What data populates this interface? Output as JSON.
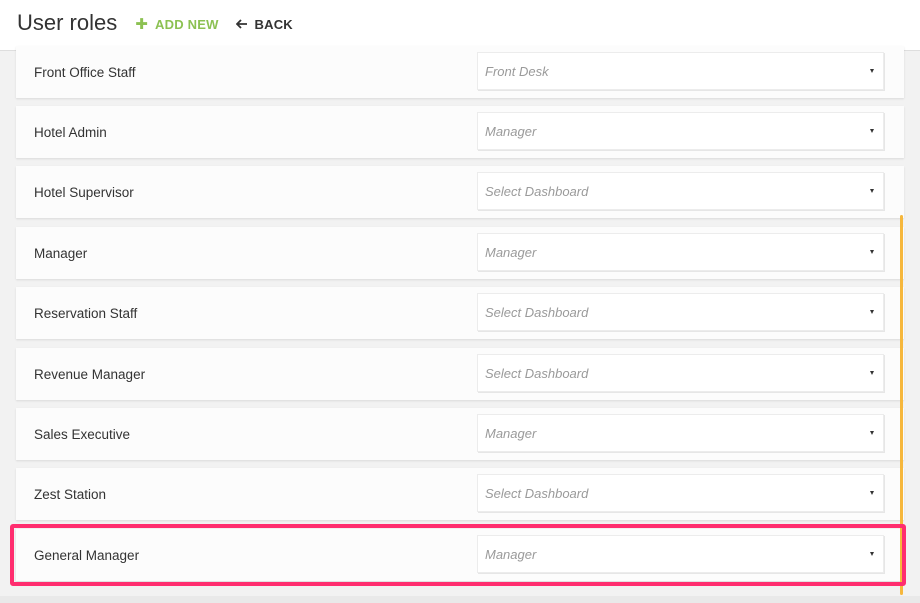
{
  "header": {
    "title": "User roles",
    "add_new_label": "ADD NEW",
    "back_label": "BACK"
  },
  "roles": [
    {
      "name": "Front Office Staff",
      "dashboard": "Front Desk"
    },
    {
      "name": "Hotel Admin",
      "dashboard": "Manager"
    },
    {
      "name": "Hotel Supervisor",
      "dashboard": "Select Dashboard"
    },
    {
      "name": "Manager",
      "dashboard": "Manager"
    },
    {
      "name": "Reservation Staff",
      "dashboard": "Select Dashboard"
    },
    {
      "name": "Revenue Manager",
      "dashboard": "Select Dashboard"
    },
    {
      "name": "Sales Executive",
      "dashboard": "Manager"
    },
    {
      "name": "Zest Station",
      "dashboard": "Select Dashboard"
    },
    {
      "name": "General Manager",
      "dashboard": "Manager"
    }
  ],
  "colors": {
    "add_new": "#8cc152",
    "highlight": "#ff2d6f",
    "scroll_indicator": "#f6b73c"
  },
  "icons": {
    "add": "plus-icon",
    "back": "arrow-left-icon",
    "dropdown": "caret-down-icon"
  }
}
